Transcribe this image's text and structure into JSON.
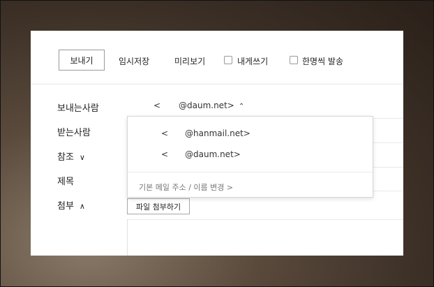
{
  "toolbar": {
    "send_label": "보내기",
    "save_draft_label": "임시저장",
    "preview_label": "미리보기",
    "to_self_label": "내게쓰기",
    "individual_send_label": "한명씩 발송"
  },
  "compose": {
    "sender_label": "보내는사람",
    "recipient_label": "받는사람",
    "cc_label": "참조",
    "subject_label": "제목",
    "attachment_label": "첨부",
    "sender_value_prefix": "<",
    "sender_value_domain": "@daum.net>",
    "attach_button_label": "파일 첨부하기"
  },
  "sender_dropdown": {
    "options": [
      {
        "prefix": "<",
        "domain": "@hanmail.net>"
      },
      {
        "prefix": "<",
        "domain": "@daum.net>"
      }
    ],
    "change_link": "기본 메일 주소 / 이름 변경 >"
  },
  "icons": {
    "cc_toggle": "chevron-down-icon",
    "attachment_toggle": "chevron-up-icon",
    "sender_toggle": "caret-up-icon"
  }
}
